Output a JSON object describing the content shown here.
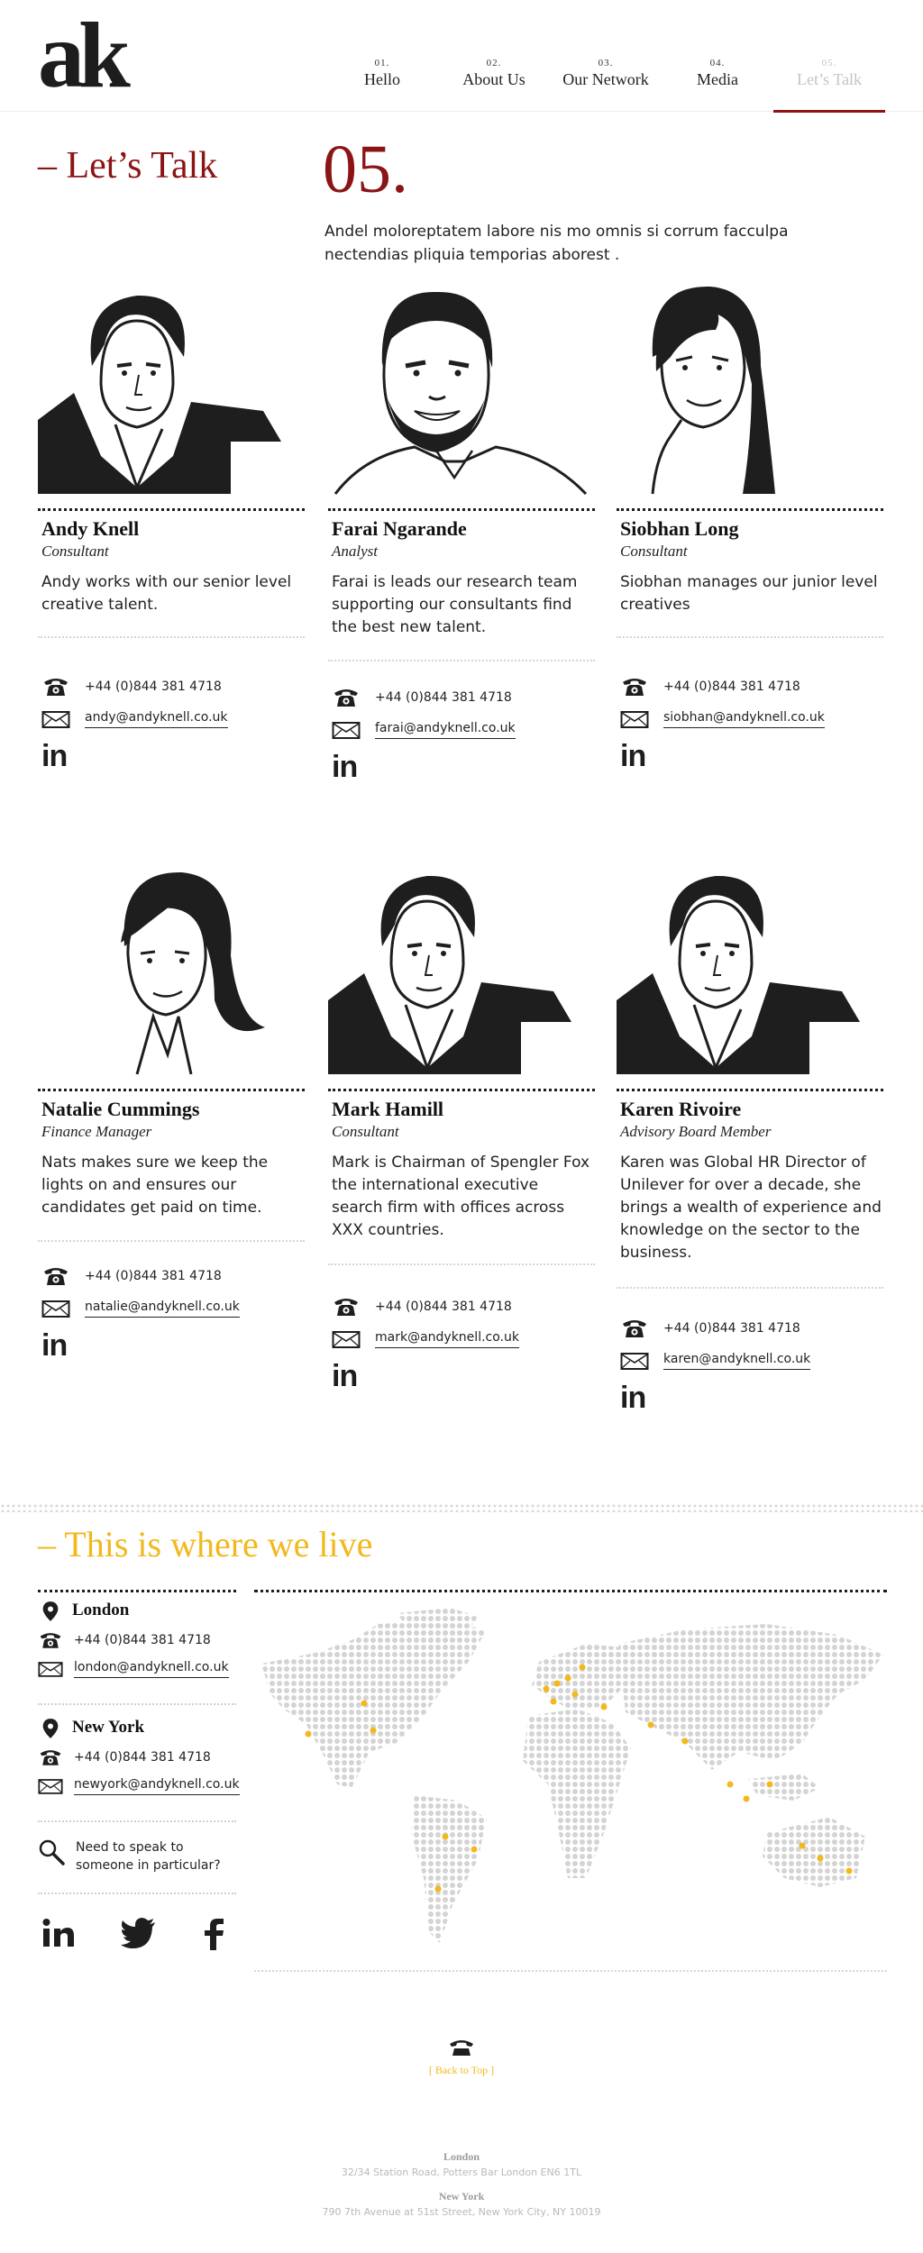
{
  "brand": {
    "logo": "ak"
  },
  "nav": [
    {
      "num": "01.",
      "label": "Hello"
    },
    {
      "num": "02.",
      "label": "About Us"
    },
    {
      "num": "03.",
      "label": "Our Network"
    },
    {
      "num": "04.",
      "label": "Media"
    },
    {
      "num": "05.",
      "label": "Let’s Talk"
    }
  ],
  "intro": {
    "title": "– Let’s Talk",
    "number": "05.",
    "text": "Andel moloreptatem labore nis mo omnis si corrum facculpa nectendias pliquia temporias aborest ."
  },
  "team": [
    {
      "name": "Andy Knell",
      "role": "Consultant",
      "bio": "Andy works with our senior level creative talent.",
      "phone": "+44 (0)844 381 4718",
      "email": "andy@andyknell.co.uk"
    },
    {
      "name": "Farai Ngarande",
      "role": "Analyst",
      "bio": "Farai is leads our research team supporting our consultants find the best new talent.",
      "phone": "+44 (0)844 381 4718",
      "email": "farai@andyknell.co.uk"
    },
    {
      "name": "Siobhan Long",
      "role": "Consultant",
      "bio": "Siobhan manages our junior level creatives",
      "phone": "+44 (0)844 381 4718",
      "email": "siobhan@andyknell.co.uk"
    },
    {
      "name": "Natalie Cummings",
      "role": "Finance Manager",
      "bio": "Nats makes sure we keep the lights on and ensures our candidates get paid on time.",
      "phone": "+44 (0)844 381 4718",
      "email": "natalie@andyknell.co.uk"
    },
    {
      "name": "Mark Hamill",
      "role": "Consultant",
      "bio": "Mark is Chairman of Spengler Fox the international executive search firm with offices across XXX countries.",
      "phone": "+44 (0)844 381 4718",
      "email": "mark@andyknell.co.uk"
    },
    {
      "name": "Karen Rivoire",
      "role": "Advisory Board Member",
      "bio": "Karen was Global HR Director of Unilever for over a decade, she brings a wealth of experience and knowledge on the sector to the business.",
      "phone": "+44 (0)844 381 4718",
      "email": "karen@andyknell.co.uk"
    }
  ],
  "linkedin_glyph": "in",
  "live": {
    "title": "– This is where we live",
    "offices": [
      {
        "city": "London",
        "phone": "+44 (0)844 381 4718",
        "email": "london@andyknell.co.uk"
      },
      {
        "city": "New York",
        "phone": "+44 (0)844 381 4718",
        "email": "newyork@andyknell.co.uk"
      }
    ],
    "speak": "Need to speak to someone in particular?"
  },
  "colors": {
    "accent_red": "#8b1515",
    "accent_yellow": "#f2b81d",
    "map_dot": "#d4d4d4",
    "ink": "#1e1e1e"
  },
  "icons": [
    "phone-icon",
    "email-icon",
    "location-pin-icon",
    "search-icon",
    "linkedin-icon",
    "twitter-icon",
    "facebook-icon",
    "back-to-top-icon"
  ],
  "footer": {
    "back_to_top": "[ Back to Top ]",
    "addresses": [
      {
        "city": "London",
        "line": "32/34 Station Road, Potters Bar  London EN6 1TL"
      },
      {
        "city": "New York",
        "line": "790 7th Avenue at 51st Street, New York City, NY 10019"
      }
    ]
  }
}
